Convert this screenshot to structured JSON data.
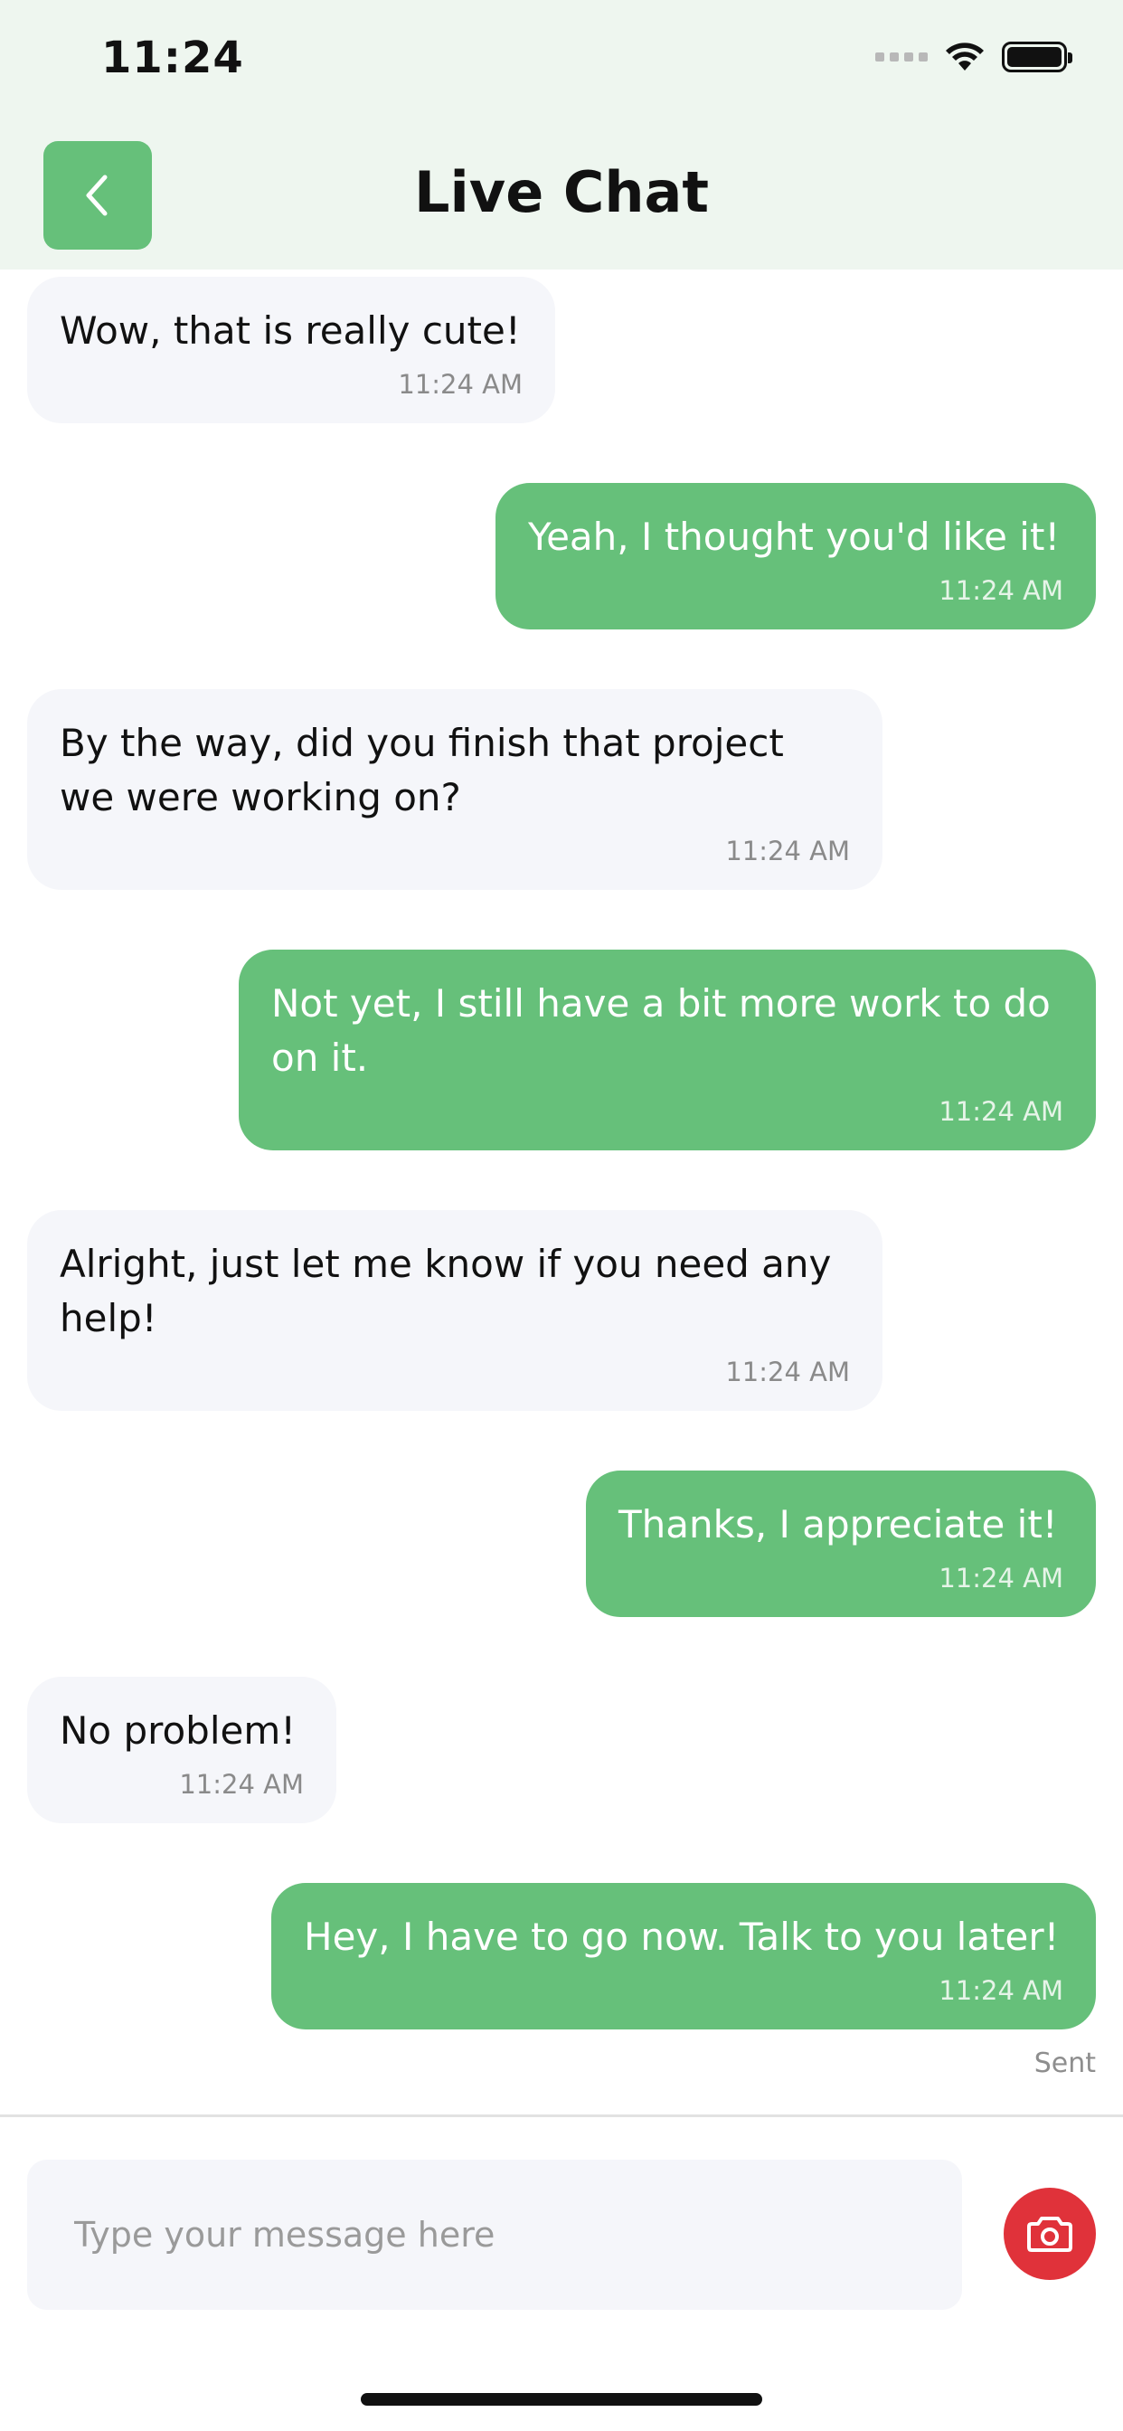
{
  "status_bar": {
    "time": "11:24"
  },
  "header": {
    "title": "Live Chat",
    "back_icon": "chevron-left-icon"
  },
  "messages": [
    {
      "direction": "in",
      "text": "Wow, that is really cute!",
      "time": "11:24 AM"
    },
    {
      "direction": "out",
      "text": "Yeah, I thought you'd like it!",
      "time": "11:24 AM"
    },
    {
      "direction": "in",
      "text": "By the way, did you finish that project\nwe were working on?",
      "time": "11:24 AM"
    },
    {
      "direction": "out",
      "text": "Not yet, I still have a bit more work to do\non it.",
      "time": "11:24 AM"
    },
    {
      "direction": "in",
      "text": "Alright, just let me know if you need any\nhelp!",
      "time": "11:24 AM"
    },
    {
      "direction": "out",
      "text": "Thanks, I appreciate it!",
      "time": "11:24 AM"
    },
    {
      "direction": "in",
      "text": "No problem!",
      "time": "11:24 AM"
    },
    {
      "direction": "out",
      "text": "Hey, I have to go now. Talk to you later!",
      "time": "11:24 AM"
    }
  ],
  "delivery_status": "Sent",
  "composer": {
    "placeholder": "Type your message here",
    "value": "",
    "camera_icon": "camera-icon"
  },
  "colors": {
    "header_bg": "#eef6ef",
    "accent_green": "#66c07a",
    "incoming_bubble": "#f5f6fa",
    "camera_button": "#e0323a"
  }
}
